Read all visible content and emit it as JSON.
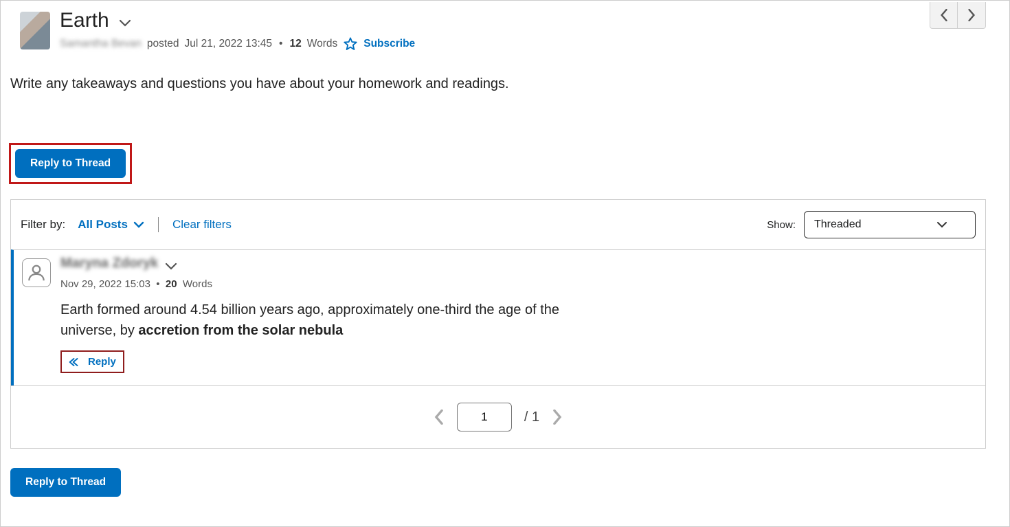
{
  "nav": {
    "prev_aria": "Previous thread",
    "next_aria": "Next thread"
  },
  "thread": {
    "title": "Earth",
    "author_display": "Samantha Bevan",
    "posted_prefix": "posted",
    "posted_date": "Jul 21, 2022 13:45",
    "word_count": "12",
    "words_label": "Words",
    "subscribe_label": "Subscribe",
    "prompt": "Write any takeaways and questions you have about your homework and readings."
  },
  "actions": {
    "reply_thread_label": "Reply to Thread"
  },
  "filter": {
    "label": "Filter by:",
    "selected": "All Posts",
    "clear_label": "Clear filters",
    "show_label": "Show:",
    "show_selected": "Threaded"
  },
  "reply": {
    "author_display": "Maryna Zdoryk",
    "date": "Nov 29, 2022 15:03",
    "word_count": "20",
    "words_label": "Words",
    "body_part1": "Earth formed around 4.54 billion years ago, approximately one-third the age of the universe, by ",
    "body_bold": "accretion from the solar nebula",
    "reply_label": "Reply"
  },
  "pager": {
    "current": "1",
    "total_sep": "/",
    "total": "1"
  }
}
